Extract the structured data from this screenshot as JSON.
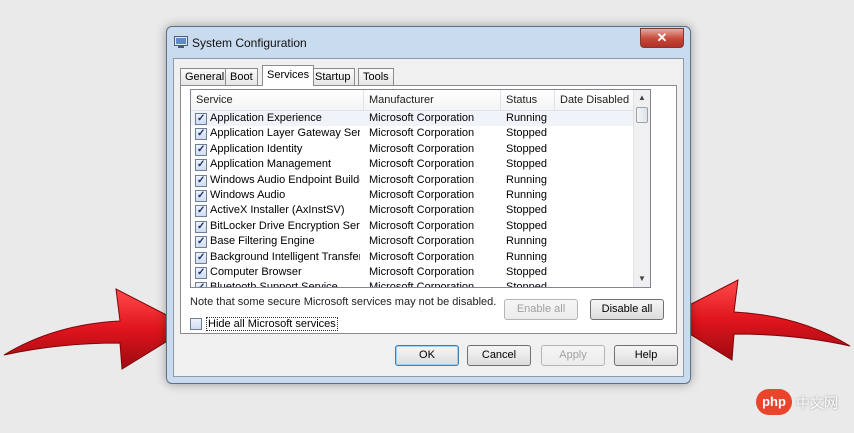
{
  "window": {
    "title": "System Configuration",
    "close_label": "✕"
  },
  "tabs": [
    {
      "label": "General",
      "active": false
    },
    {
      "label": "Boot",
      "active": false
    },
    {
      "label": "Services",
      "active": true
    },
    {
      "label": "Startup",
      "active": false
    },
    {
      "label": "Tools",
      "active": false
    }
  ],
  "list": {
    "columns": [
      "Service",
      "Manufacturer",
      "Status",
      "Date Disabled"
    ],
    "rows": [
      {
        "service": "Application Experience",
        "manufacturer": "Microsoft Corporation",
        "status": "Running",
        "checked": true
      },
      {
        "service": "Application Layer Gateway Service",
        "manufacturer": "Microsoft Corporation",
        "status": "Stopped",
        "checked": true
      },
      {
        "service": "Application Identity",
        "manufacturer": "Microsoft Corporation",
        "status": "Stopped",
        "checked": true
      },
      {
        "service": "Application Management",
        "manufacturer": "Microsoft Corporation",
        "status": "Stopped",
        "checked": true
      },
      {
        "service": "Windows Audio Endpoint Builder",
        "manufacturer": "Microsoft Corporation",
        "status": "Running",
        "checked": true
      },
      {
        "service": "Windows Audio",
        "manufacturer": "Microsoft Corporation",
        "status": "Running",
        "checked": true
      },
      {
        "service": "ActiveX Installer (AxInstSV)",
        "manufacturer": "Microsoft Corporation",
        "status": "Stopped",
        "checked": true
      },
      {
        "service": "BitLocker Drive Encryption Service",
        "manufacturer": "Microsoft Corporation",
        "status": "Stopped",
        "checked": true
      },
      {
        "service": "Base Filtering Engine",
        "manufacturer": "Microsoft Corporation",
        "status": "Running",
        "checked": true
      },
      {
        "service": "Background Intelligent Transfer ...",
        "manufacturer": "Microsoft Corporation",
        "status": "Running",
        "checked": true
      },
      {
        "service": "Computer Browser",
        "manufacturer": "Microsoft Corporation",
        "status": "Stopped",
        "checked": true
      },
      {
        "service": "Bluetooth Support Service",
        "manufacturer": "Microsoft Corporation",
        "status": "Stopped",
        "checked": true
      }
    ]
  },
  "note": "Note that some secure Microsoft services may not be disabled.",
  "buttons": {
    "enable_all": "Enable all",
    "disable_all": "Disable all",
    "ok": "OK",
    "cancel": "Cancel",
    "apply": "Apply",
    "help": "Help"
  },
  "hide_ms": {
    "label": "Hide all Microsoft services",
    "checked": false
  },
  "colors": {
    "arrow_red": "#e0141d",
    "watermark_red": "#e8452c"
  },
  "watermark": {
    "logo": "php",
    "text": "中文网"
  }
}
